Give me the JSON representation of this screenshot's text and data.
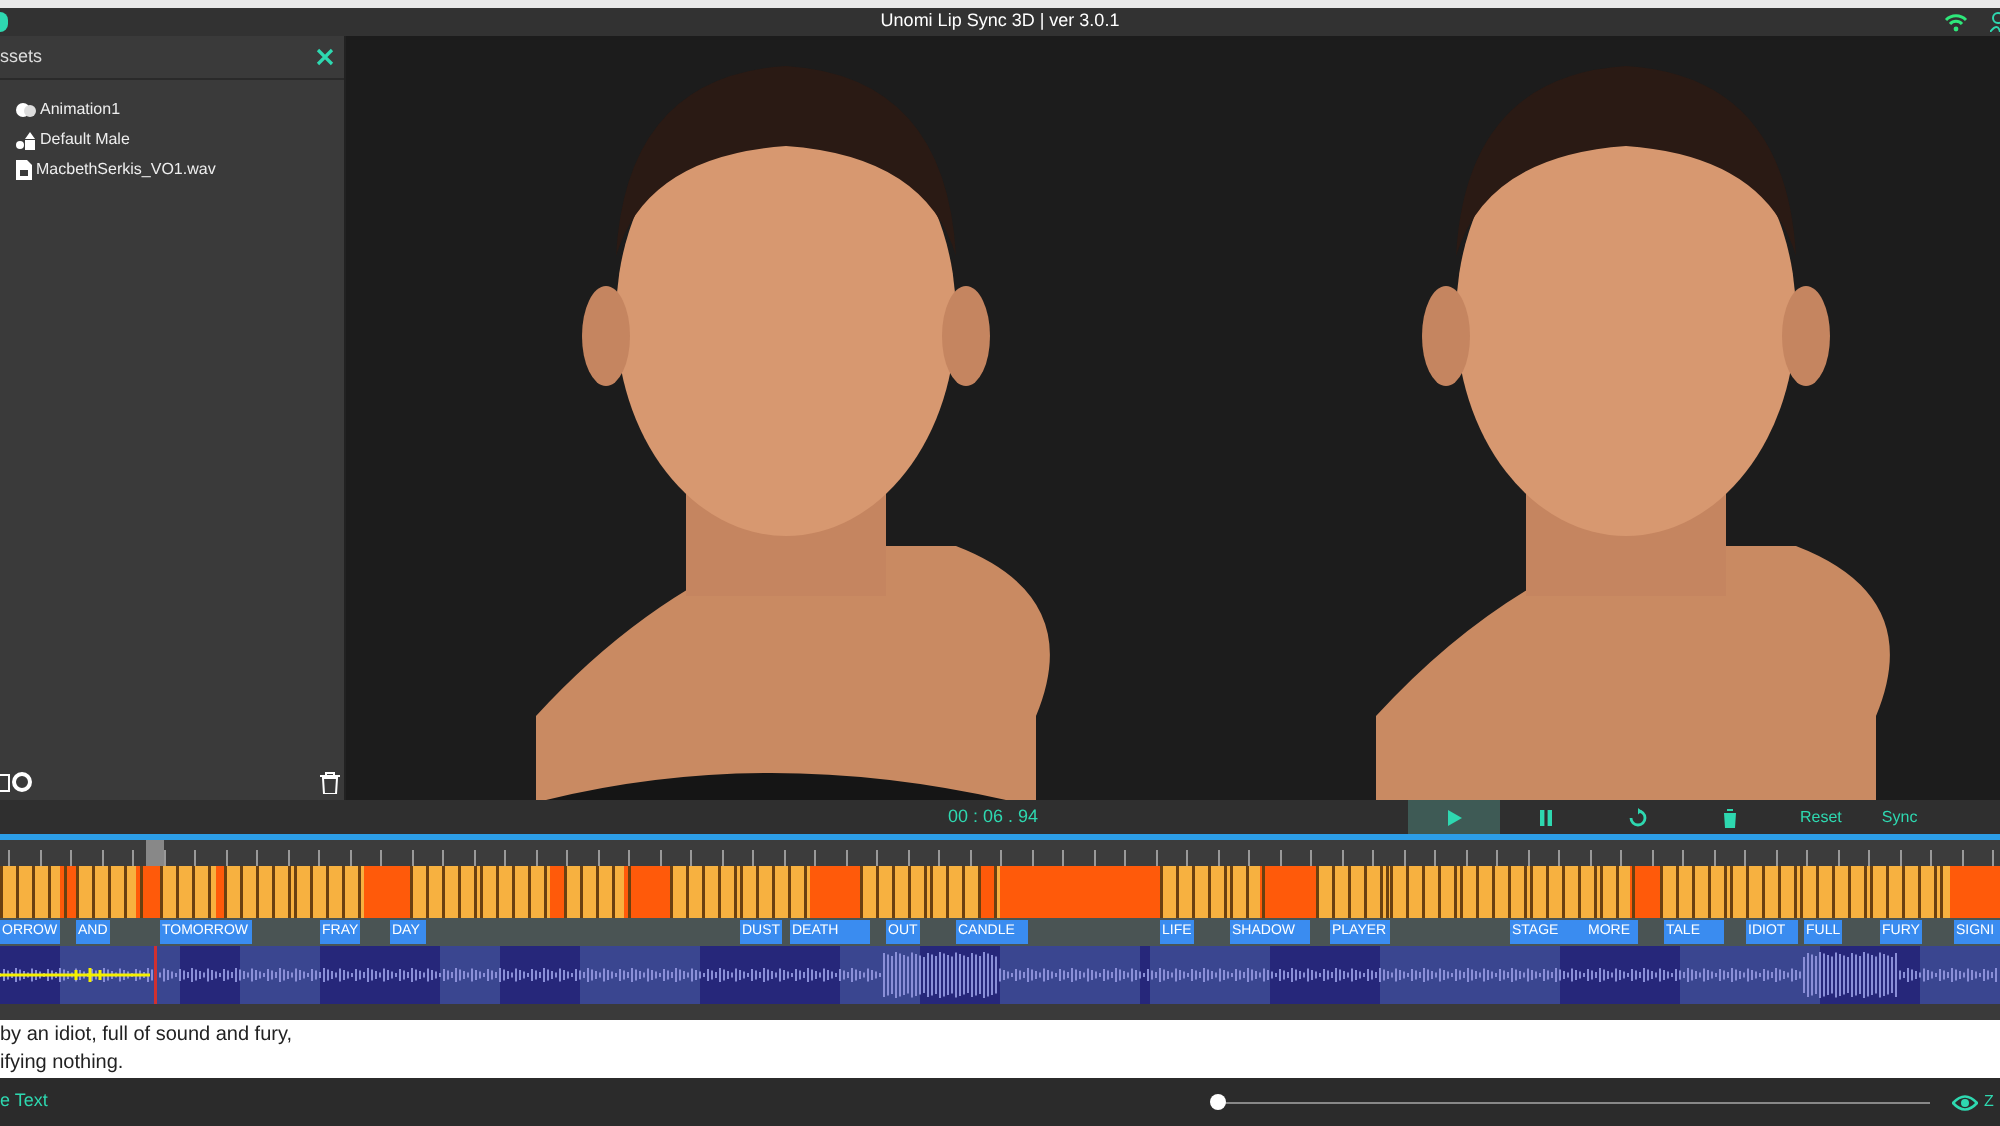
{
  "window": {
    "title": "Unomi Lip Sync 3D | ver 3.0.1"
  },
  "assets_panel": {
    "title": "ssets",
    "items": [
      {
        "kind": "animation",
        "label": "Animation1"
      },
      {
        "kind": "model",
        "label": "Default Male"
      },
      {
        "kind": "audio",
        "label": "MacbethSerkis_VO1.wav"
      }
    ]
  },
  "transport": {
    "time": "00 : 06 . 94",
    "buttons": [
      {
        "kind": "play",
        "selected": true
      },
      {
        "kind": "pause",
        "selected": false
      },
      {
        "kind": "restart",
        "selected": false
      },
      {
        "kind": "delete",
        "selected": false
      }
    ],
    "actions": [
      "Reset",
      "Sync"
    ]
  },
  "word_track": [
    "ORROW",
    "AND",
    "TOMORROW",
    "FRAY",
    "DAY",
    "DUST",
    "DEATH",
    "OUT",
    "CANDLE",
    "LIFE",
    "SHADOW",
    "PLAYER",
    "STAGE",
    "MORE",
    "TALE",
    "IDIOT",
    "FULL",
    "FURY",
    "SIGNI"
  ],
  "script_text": [
    "by an idiot, full of sound and fury,",
    "ifying nothing."
  ],
  "bottom_bar": {
    "link": "e Text",
    "zoom": {
      "level": 0,
      "label": "Z"
    }
  }
}
